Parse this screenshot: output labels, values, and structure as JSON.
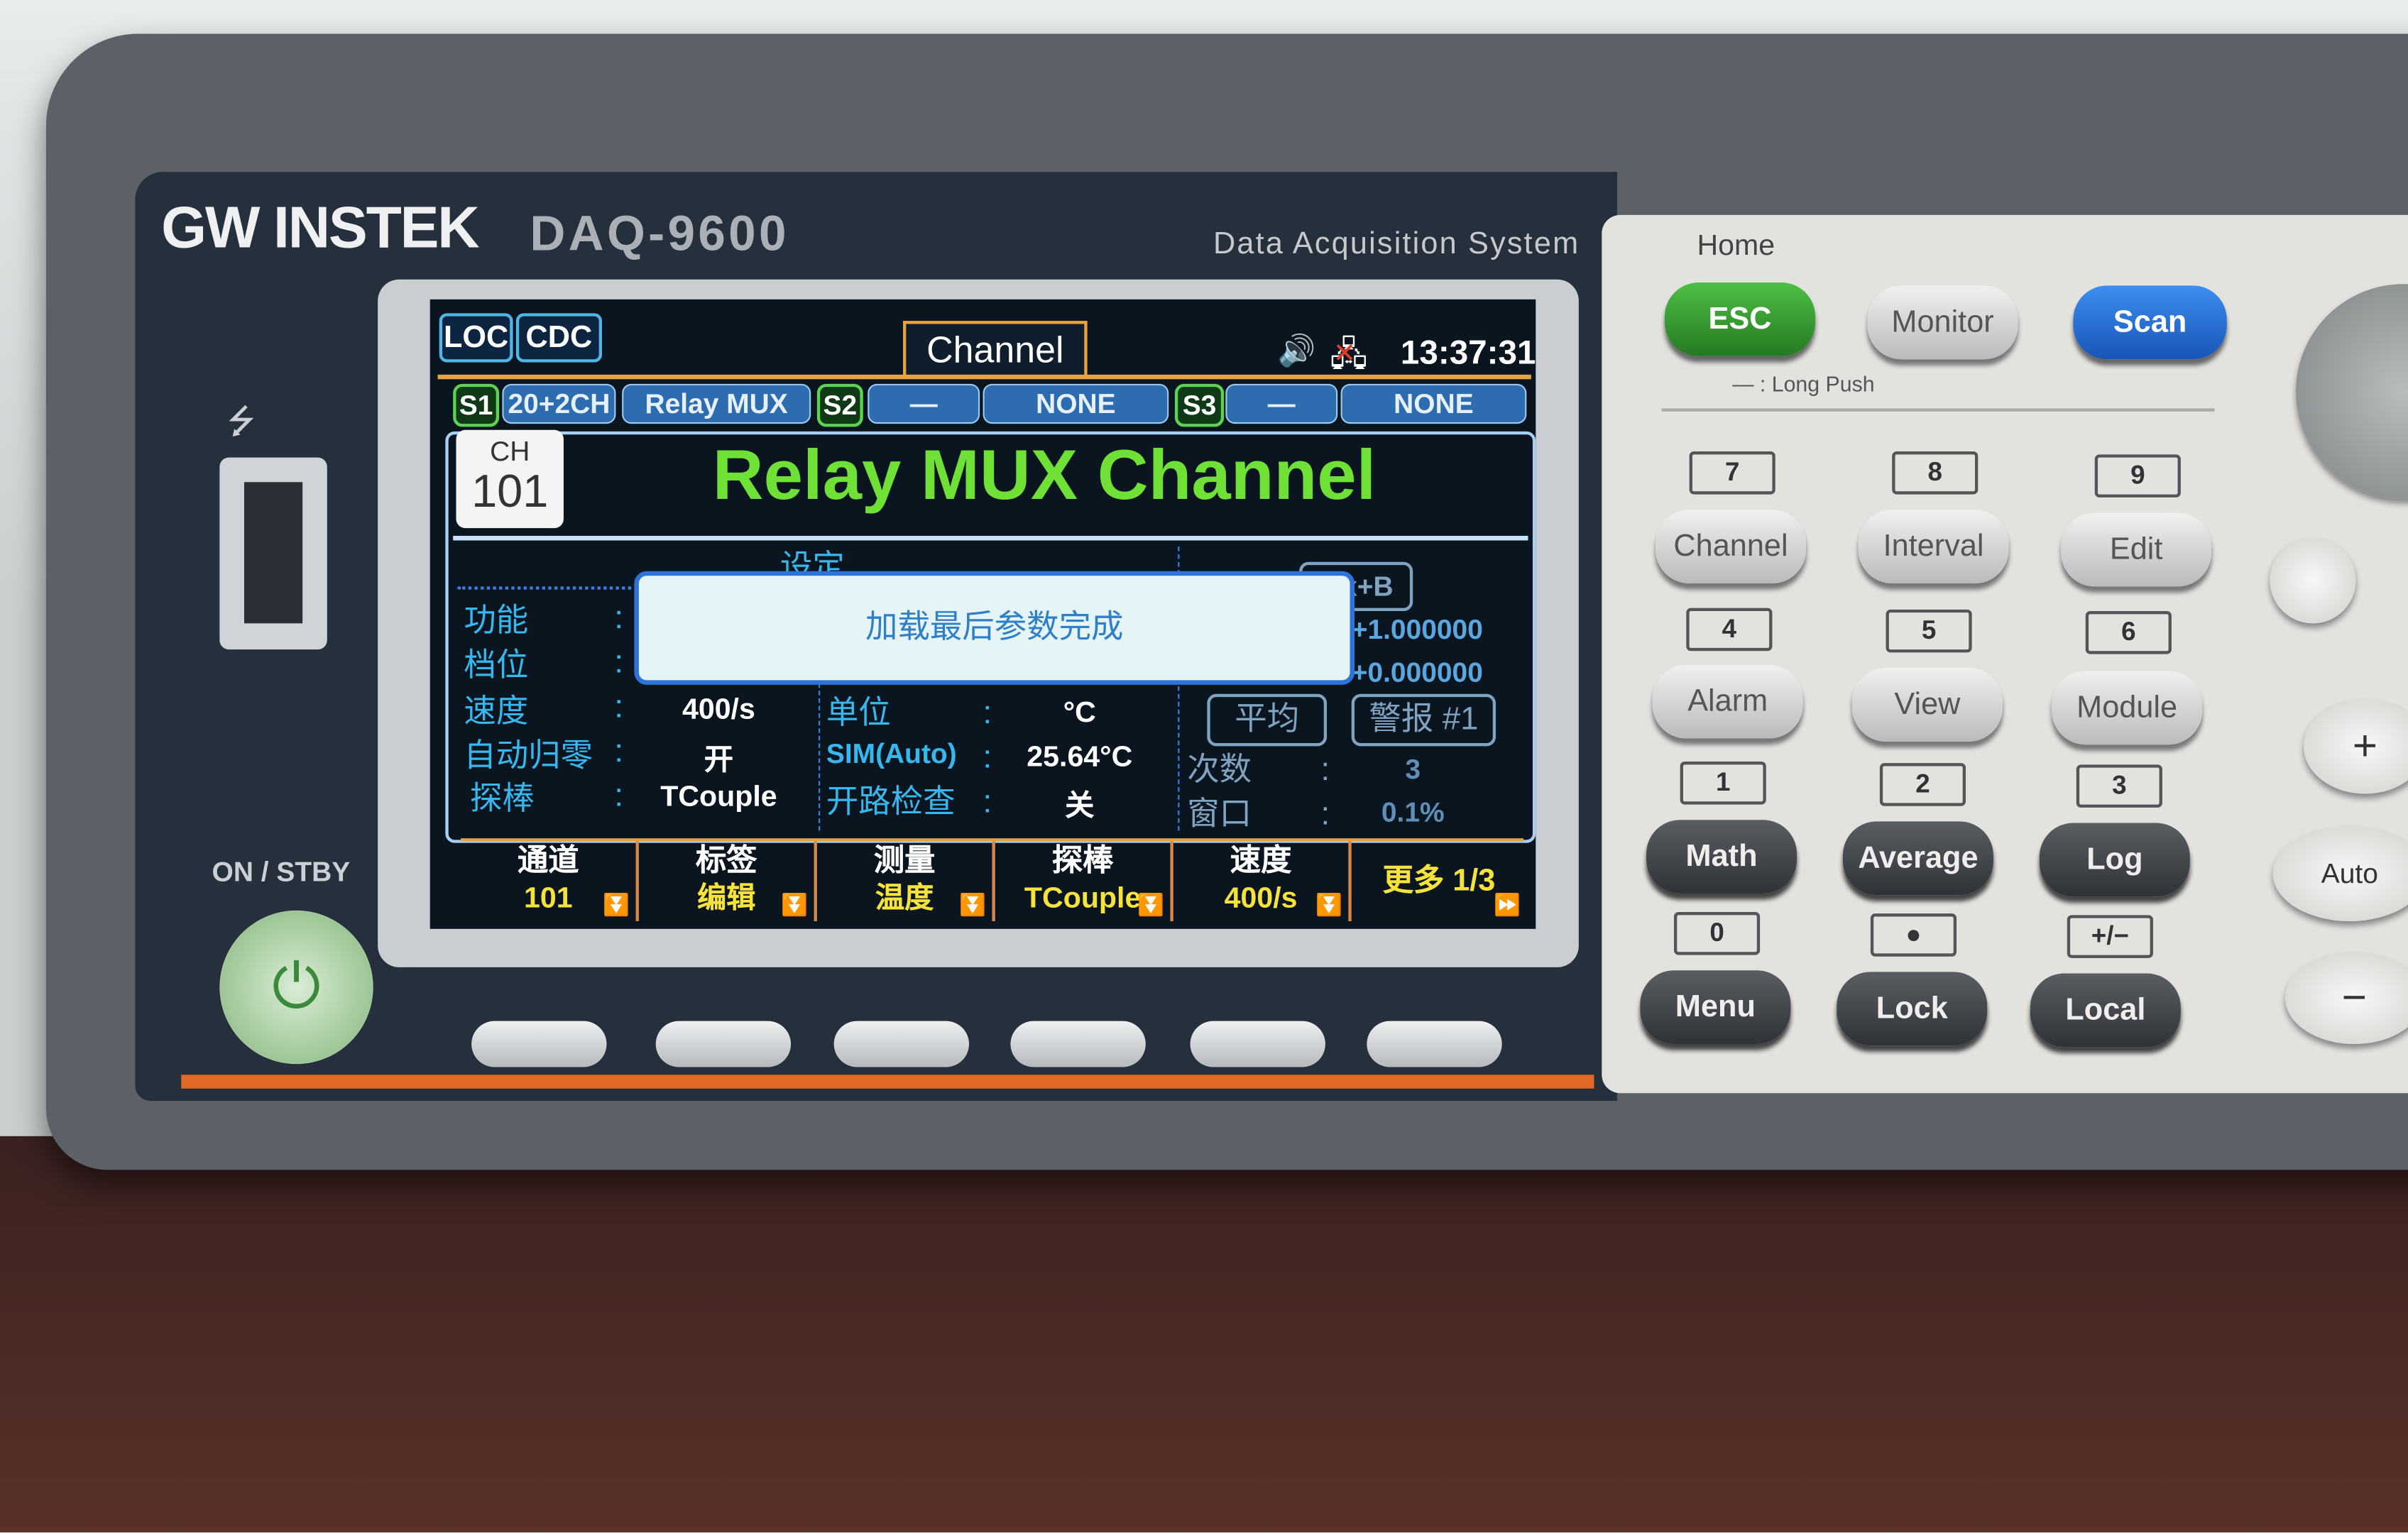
{
  "device": {
    "brand": "GW INSTEK",
    "model": "DAQ-9600",
    "subtitle": "Data Acquisition System",
    "power_label": "ON / STBY"
  },
  "status_bar": {
    "badges": [
      "LOC",
      "CDC"
    ],
    "tab": "Channel",
    "time": "13:37:31",
    "icons": [
      "speaker-icon",
      "network-disconnected-icon"
    ]
  },
  "slots": [
    {
      "id": "S1",
      "type": "20+2CH",
      "card": "Relay MUX"
    },
    {
      "id": "S2",
      "type": "—",
      "card": "NONE"
    },
    {
      "id": "S3",
      "type": "—",
      "card": "NONE"
    }
  ],
  "channel": {
    "ch_label": "CH",
    "number": "101",
    "title": "Relay MUX Channel"
  },
  "settings": {
    "header": "设定",
    "left": [
      {
        "label": "功能",
        "value": ""
      },
      {
        "label": "档位",
        "value": ""
      },
      {
        "label": "速度",
        "value": "400/s"
      },
      {
        "label": "自动归零",
        "value": "开"
      },
      {
        "label": "探棒",
        "value": "TCouple"
      }
    ],
    "middle": [
      {
        "label": "单位",
        "value": "°C"
      },
      {
        "label": "SIM(Auto)",
        "value": "25.64°C"
      },
      {
        "label": "开路检查",
        "value": "关"
      }
    ],
    "mxb": {
      "label": "Mx+B",
      "m": "+1.000000",
      "b": "+0.000000"
    },
    "average_label": "平均",
    "alarm_label": "警报 #1",
    "count": {
      "label": "次数",
      "value": "3"
    },
    "window": {
      "label": "窗口",
      "value": "0.1%"
    }
  },
  "dialog": {
    "message": "加载最后参数完成"
  },
  "softkeys": [
    {
      "top": "通道",
      "bottom": "101"
    },
    {
      "top": "标签",
      "bottom": "编辑"
    },
    {
      "top": "测量",
      "bottom": "温度"
    },
    {
      "top": "探棒",
      "bottom": "TCouple"
    },
    {
      "top": "速度",
      "bottom": "400/s"
    },
    {
      "top": "更多 1/3",
      "bottom": ""
    }
  ],
  "keypad": {
    "home_label": "Home",
    "long_push": "— : Long Push",
    "top_keys": [
      "ESC",
      "Monitor",
      "Scan"
    ],
    "rows": [
      {
        "nums": [
          "7",
          "8",
          "9"
        ],
        "keys": [
          "Channel",
          "Interval",
          "Edit"
        ]
      },
      {
        "nums": [
          "4",
          "5",
          "6"
        ],
        "keys": [
          "Alarm",
          "View",
          "Module"
        ]
      },
      {
        "nums": [
          "1",
          "2",
          "3"
        ],
        "keys": [
          "Math",
          "Average",
          "Log"
        ]
      },
      {
        "nums": [
          "0",
          "●",
          "+/−"
        ],
        "keys": [
          "Menu",
          "Lock",
          "Local"
        ]
      }
    ],
    "side": {
      "plus": "+",
      "auto": "Auto",
      "minus": "−"
    }
  },
  "colors": {
    "esc": "#2f9a2f",
    "scan": "#1f6fd6",
    "title_green": "#6fe035",
    "accent_orange": "#e8a340"
  }
}
